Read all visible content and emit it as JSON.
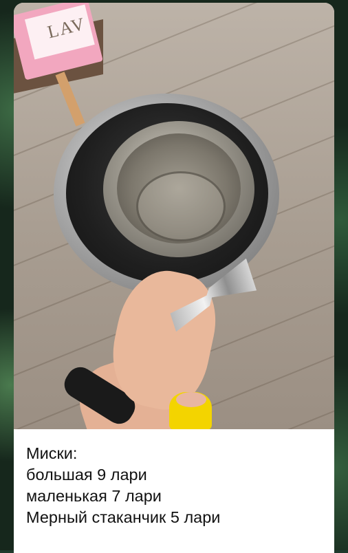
{
  "message": {
    "caption_lines": [
      "Миски:",
      "большая 9 лари",
      "маленькая 7 лари",
      "Мерный стаканчик 5 лари"
    ],
    "photo_box_text": "LAV"
  },
  "colors": {
    "chat_background": "#1f3a2c",
    "bubble_background": "#ffffff",
    "text": "#111111"
  }
}
